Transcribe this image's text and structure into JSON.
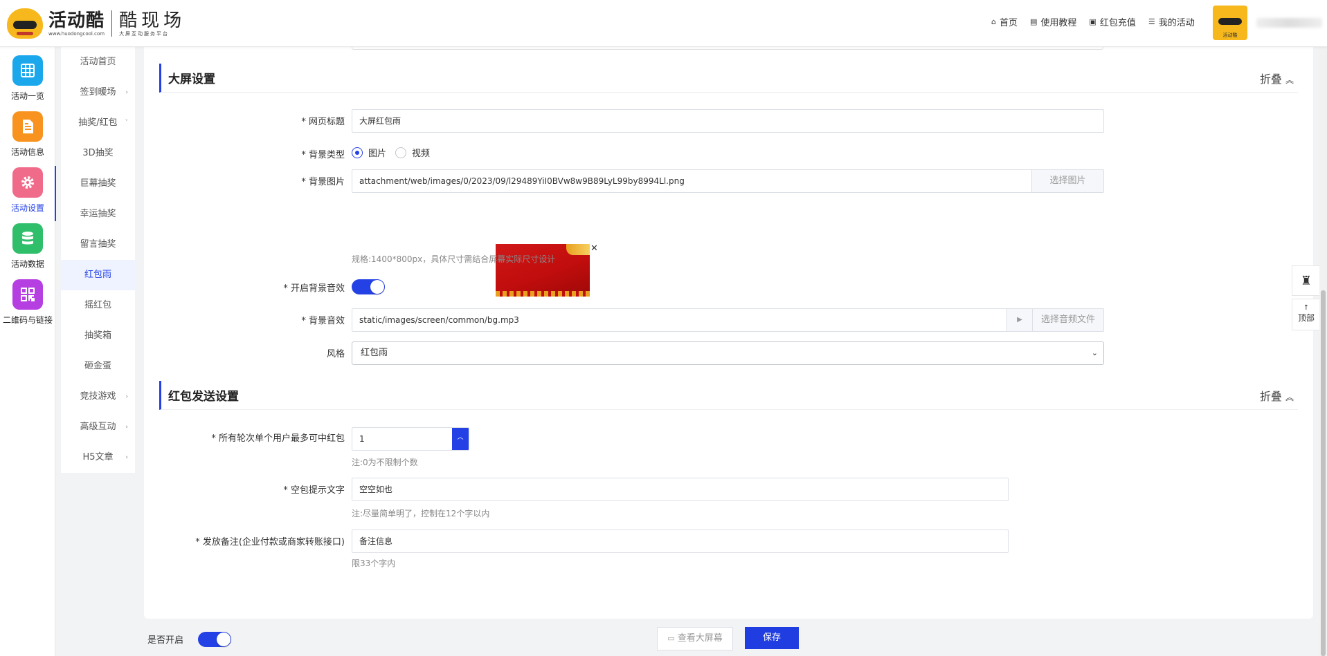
{
  "header": {
    "logo_name": "活动酷",
    "logo_url": "www.huodongcool.com",
    "logo_brand": "酷现场",
    "logo_tagline": "大屏互动服务平台",
    "nav": [
      {
        "icon": "home-icon",
        "label": "首页"
      },
      {
        "icon": "book-icon",
        "label": "使用教程"
      },
      {
        "icon": "wallet-icon",
        "label": "红包充值"
      },
      {
        "icon": "list-icon",
        "label": "我的活动"
      }
    ],
    "avatar_label": "活动酷"
  },
  "sidebar": {
    "items": [
      {
        "label": "活动一览",
        "icon": "grid-icon",
        "color": "#1aa7ec"
      },
      {
        "label": "活动信息",
        "icon": "document-icon",
        "color": "#f7931e"
      },
      {
        "label": "活动设置",
        "icon": "gear-icon",
        "color": "#f06a8a"
      },
      {
        "label": "活动数据",
        "icon": "database-icon",
        "color": "#2fbf6b"
      },
      {
        "label": "二维码与链接",
        "icon": "qrcode-icon",
        "color": "#b53fe0"
      }
    ],
    "active_index": 2
  },
  "subnav": {
    "items": [
      {
        "label": "活动首页",
        "arrow": ""
      },
      {
        "label": "签到暖场",
        "arrow": "›"
      },
      {
        "label": "抽奖/红包",
        "arrow": "ˇ"
      },
      {
        "label": "3D抽奖",
        "arrow": ""
      },
      {
        "label": "巨幕抽奖",
        "arrow": ""
      },
      {
        "label": "幸运抽奖",
        "arrow": ""
      },
      {
        "label": "留言抽奖",
        "arrow": ""
      },
      {
        "label": "红包雨",
        "arrow": ""
      },
      {
        "label": "摇红包",
        "arrow": ""
      },
      {
        "label": "抽奖箱",
        "arrow": ""
      },
      {
        "label": "砸金蛋",
        "arrow": ""
      },
      {
        "label": "竞技游戏",
        "arrow": "›"
      },
      {
        "label": "高级互动",
        "arrow": "›"
      },
      {
        "label": "H5文章",
        "arrow": "›"
      }
    ],
    "active_index": 7
  },
  "screen_settings": {
    "title": "大屏设置",
    "fold_label": "折叠",
    "page_title_label": "* 网页标题",
    "page_title_value": "大屏红包雨",
    "bg_type_label": "* 背景类型",
    "bg_type_options": [
      "图片",
      "视频"
    ],
    "bg_type_selected": "图片",
    "bg_image_label": "* 背景图片",
    "bg_image_value": "attachment/web/images/0/2023/09/l29489YiI0BVw8w9B89LyL99by8994Ll.png",
    "bg_image_button": "选择图片",
    "bg_image_spec": "规格:1400*800px，具体尺寸需结合屏幕实际尺寸设计",
    "bg_music_enable_label": "* 开启背景音效",
    "bg_music_enabled": true,
    "bg_music_label": "* 背景音效",
    "bg_music_value": "static/images/screen/common/bg.mp3",
    "bg_music_button": "选择音频文件",
    "style_label": "风格",
    "style_value": "红包雨"
  },
  "redpacket_settings": {
    "title": "红包发送设置",
    "fold_label": "折叠",
    "max_per_user_label": "* 所有轮次单个用户最多可中红包",
    "max_per_user_value": "1",
    "max_per_user_hint": "注:0为不限制个数",
    "empty_text_label": "* 空包提示文字",
    "empty_text_value": "空空如也",
    "empty_text_hint": "注:尽量简单明了，控制在12个字以内",
    "remark_label": "* 发放备注(企业付款或商家转账接口)",
    "remark_value": "备注信息",
    "remark_hint": "限33个字内"
  },
  "footer": {
    "enabled_label": "是否开启",
    "enabled": true,
    "preview_button": "查看大屏幕",
    "save_button": "保存"
  },
  "float_panel": {
    "top_label": "顶部"
  },
  "colors": {
    "accent": "#2441e6",
    "save": "#1f3de0"
  }
}
